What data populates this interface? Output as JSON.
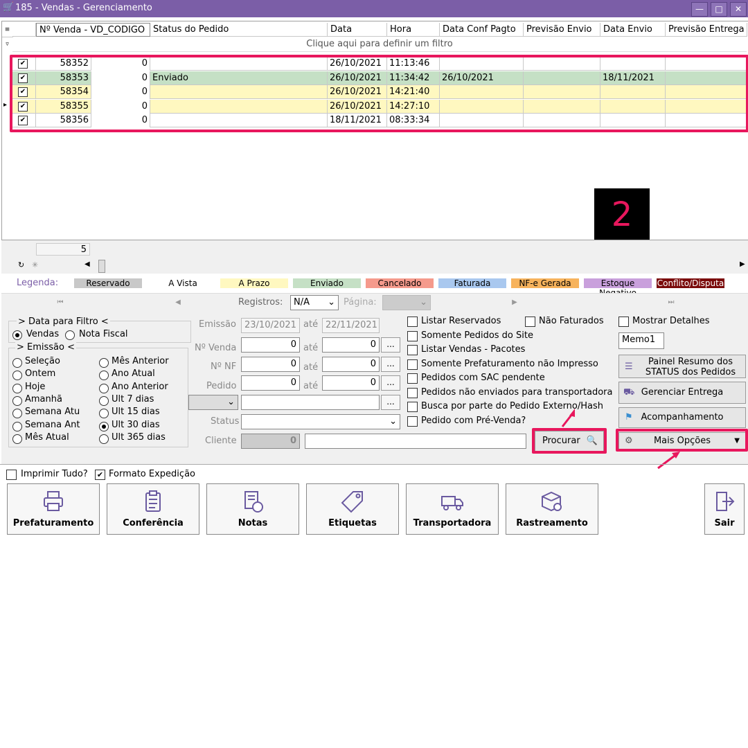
{
  "window": {
    "title": "185 - Vendas - Gerenciamento"
  },
  "grid": {
    "columns": [
      "Nº Venda - VD_CODIGO",
      "Status do Pedido",
      "Data",
      "Hora",
      "Data Conf Pagto",
      "Previsão Envio",
      "Data Envio",
      "Previsão Entrega"
    ],
    "filter_hint": "Clique aqui para definir um filtro",
    "rows": [
      {
        "id": "58352",
        "n": "0",
        "status": "",
        "data": "26/10/2021",
        "hora": "11:13:46",
        "conf": "",
        "prev": "",
        "envio": "",
        "color": "#ffffff"
      },
      {
        "id": "58353",
        "n": "0",
        "status": "Enviado",
        "data": "26/10/2021",
        "hora": "11:34:42",
        "conf": "26/10/2021",
        "prev": "",
        "envio": "18/11/2021",
        "color": "#c5e0c5"
      },
      {
        "id": "58354",
        "n": "0",
        "status": "",
        "data": "26/10/2021",
        "hora": "14:21:40",
        "conf": "",
        "prev": "",
        "envio": "",
        "color": "#fff8c0"
      },
      {
        "id": "58355",
        "n": "0",
        "status": "",
        "data": "26/10/2021",
        "hora": "14:27:10",
        "conf": "",
        "prev": "",
        "envio": "",
        "color": "#fff8c0"
      },
      {
        "id": "58356",
        "n": "0",
        "status": "",
        "data": "18/11/2021",
        "hora": "08:33:34",
        "conf": "",
        "prev": "",
        "envio": "",
        "color": "#ffffff"
      }
    ],
    "count": "5"
  },
  "annotation_badge": "2",
  "legend": {
    "label": "Legenda:",
    "items": [
      {
        "text": "Reservado",
        "bg": "#c8c8c8",
        "fg": "#000"
      },
      {
        "text": "A Vista",
        "bg": "#ffffff",
        "fg": "#000"
      },
      {
        "text": "A Prazo",
        "bg": "#fff8c0",
        "fg": "#000"
      },
      {
        "text": "Enviado",
        "bg": "#c5e0c5",
        "fg": "#000"
      },
      {
        "text": "Cancelado",
        "bg": "#f59a8c",
        "fg": "#000"
      },
      {
        "text": "Faturada",
        "bg": "#a9c8ef",
        "fg": "#000"
      },
      {
        "text": "NF-e Gerada",
        "bg": "#f7b35c",
        "fg": "#000"
      },
      {
        "text": "Estoque Negativo",
        "bg": "#c9a0dc",
        "fg": "#000"
      },
      {
        "text": "Conflito/Disputa",
        "bg": "#7a0a0a",
        "fg": "#fff"
      }
    ]
  },
  "pager": {
    "registros_label": "Registros:",
    "registros_value": "N/A",
    "pagina_label": "Página:"
  },
  "filters": {
    "data_title": "> Data para Filtro <",
    "vendas": "Vendas",
    "nota": "Nota Fiscal",
    "emissao_title": "> Emissão <",
    "periodos_left": [
      "Seleção",
      "Ontem",
      "Hoje",
      "Amanhã",
      "Semana Atu",
      "Semana Ant",
      "Mês Atual"
    ],
    "periodos_right": [
      "Mês Anterior",
      "Ano Atual",
      "Ano Anterior",
      "Ult 7 dias",
      "Ult 15 dias",
      "Ult 30 dias",
      "Ult 365 dias"
    ],
    "emissao_label": "Emissão",
    "ate": "até",
    "emissao_de": "23/10/2021",
    "emissao_ate": "22/11/2021",
    "nvenda_label": "Nº Venda",
    "nnf_label": "Nº NF",
    "pedido_label": "Pedido",
    "status_label": "Status",
    "cliente_label": "Cliente",
    "zero": "0",
    "dots": "...",
    "checks": [
      "Listar Reservados",
      "Somente Pedidos do Site",
      "Listar Vendas - Pacotes",
      "Somente Prefaturamento não Impresso",
      "Pedidos com SAC pendente",
      "Pedidos não enviados para transportadora",
      "Busca por parte do Pedido Externo/Hash",
      "Pedido com Pré-Venda?"
    ],
    "nao_faturados": "Não Faturados",
    "mostrar_detalhes": "Mostrar Detalhes",
    "memo": "Memo1",
    "procurar": "Procurar"
  },
  "right_buttons": {
    "painel_1": "Painel Resumo dos",
    "painel_2": "STATUS dos Pedidos",
    "entrega": "Gerenciar Entrega",
    "acomp": "Acompanhamento",
    "mais": "Mais Opções"
  },
  "bottom": {
    "imprimir": "Imprimir Tudo?",
    "formato": "Formato Expedição",
    "buttons": [
      "Prefaturamento",
      "Conferência",
      "Notas",
      "Etiquetas",
      "Transportadora",
      "Rastreamento"
    ],
    "sair": "Sair"
  },
  "colors": {
    "titlebar": "#7b5ea7",
    "highlight": "#e8175d"
  }
}
